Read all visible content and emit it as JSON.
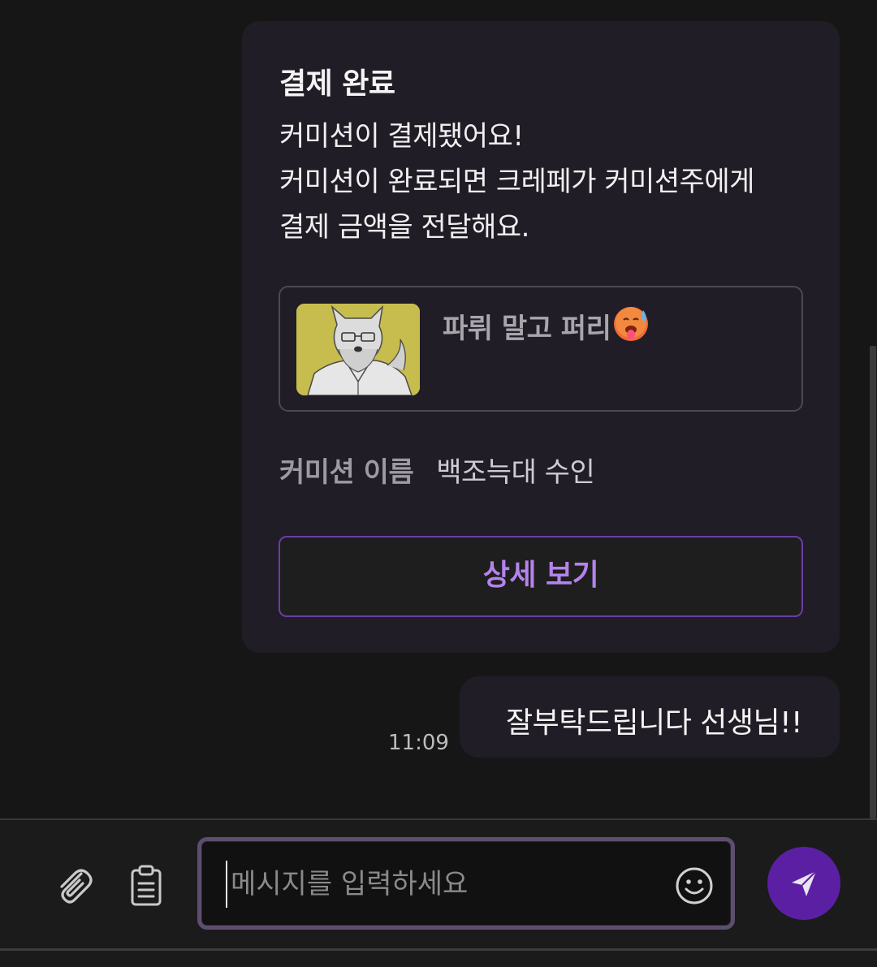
{
  "payment_card": {
    "title": "결제 완료",
    "body_lines": [
      "커미션이 결제됐어요!",
      "커미션이 완료되면 크레페가 커미션주에게",
      "결제 금액을 전달해요."
    ],
    "artist": {
      "name": "파뤼 말고 퍼리",
      "thumbnail_icon": "wolf-portrait-thumbnail",
      "emoji_icon": "hot-face-emoji"
    },
    "commission": {
      "label": "커미션 이름",
      "value": "백조늑대 수인"
    },
    "detail_button_label": "상세 보기"
  },
  "sent_message": {
    "text": "잘부탁드립니다 선생님!!",
    "time": "11:09"
  },
  "composer": {
    "placeholder": "메시지를 입력하세요",
    "value": "",
    "icons": {
      "attach": "paperclip-icon",
      "clipboard": "clipboard-icon",
      "emoji": "smiley-icon",
      "send": "send-icon"
    }
  },
  "colors": {
    "background": "#161616",
    "bubble": "#211d26",
    "accent": "#5b1fa3",
    "accent_text": "#b483ec",
    "input_border": "#5d4e70"
  }
}
